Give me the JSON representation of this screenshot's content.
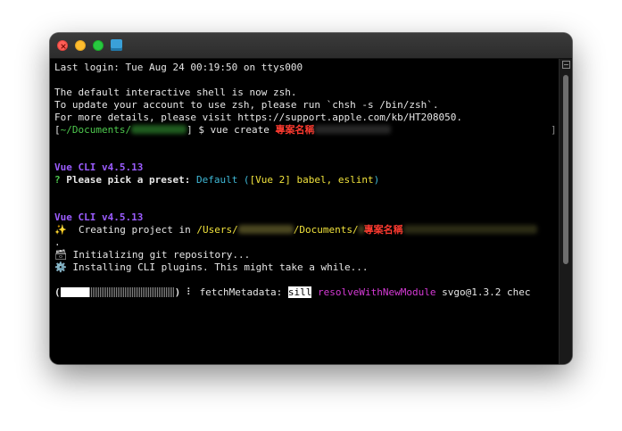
{
  "window": {
    "title": "",
    "controls": {
      "close": "close-icon",
      "minimize": "minimize-icon",
      "zoom": "zoom-icon"
    },
    "proxy_icon": "folder-icon"
  },
  "terminal": {
    "last_login": "Last login: Tue Aug 24 00:19:50 on ttys000",
    "shell_notice_1": "The default interactive shell is now zsh.",
    "shell_notice_2": "To update your account to use zsh, please run `chsh -s /bin/zsh`.",
    "shell_notice_3": "For more details, please visit https://support.apple.com/kb/HT208050.",
    "prompt": {
      "open_bracket": "[",
      "path": "~/Documents/",
      "close_bracket": "]",
      "dollar": " $ ",
      "command": "vue create ",
      "project_name": "專案名稱",
      "right_bracket": "]"
    },
    "vue_cli_1": "Vue CLI v4.5.13",
    "preset_prompt": {
      "mark": "? ",
      "question": "Please pick a preset: ",
      "answer_default": "Default (",
      "answer_options": "[Vue 2] babel, eslint",
      "answer_close": ")"
    },
    "vue_cli_2": "Vue CLI v4.5.13",
    "creating": {
      "icon": "✨",
      "text": "  Creating project in ",
      "path_start": "/Users/",
      "path_mid": "/Documents/",
      "project_name": "專案名稱"
    },
    "dot": ".",
    "init_git": {
      "icon": "🗃",
      "text": " Initializing git repository..."
    },
    "installing": {
      "icon": "⚙️",
      "text": " Installing CLI plugins. This might take a while..."
    },
    "progress": {
      "open": "(",
      "fill_fraction": 0.25,
      "close": ")",
      "spinner": " ⠇ ",
      "label": "fetchMetadata: ",
      "level": "sill",
      "action": " resolveWithNewModule",
      "package": " svgo@1.3.2 chec"
    }
  },
  "colors": {
    "background": "#000000",
    "text": "#e6e6e6",
    "prompt_path": "#4ec94e",
    "vue_cli": "#9b5cff",
    "preset_answer": "#3fb8d6",
    "preset_options": "#f0e23c",
    "npm_action": "#d63ad6",
    "annotation": "#ff3b30"
  }
}
